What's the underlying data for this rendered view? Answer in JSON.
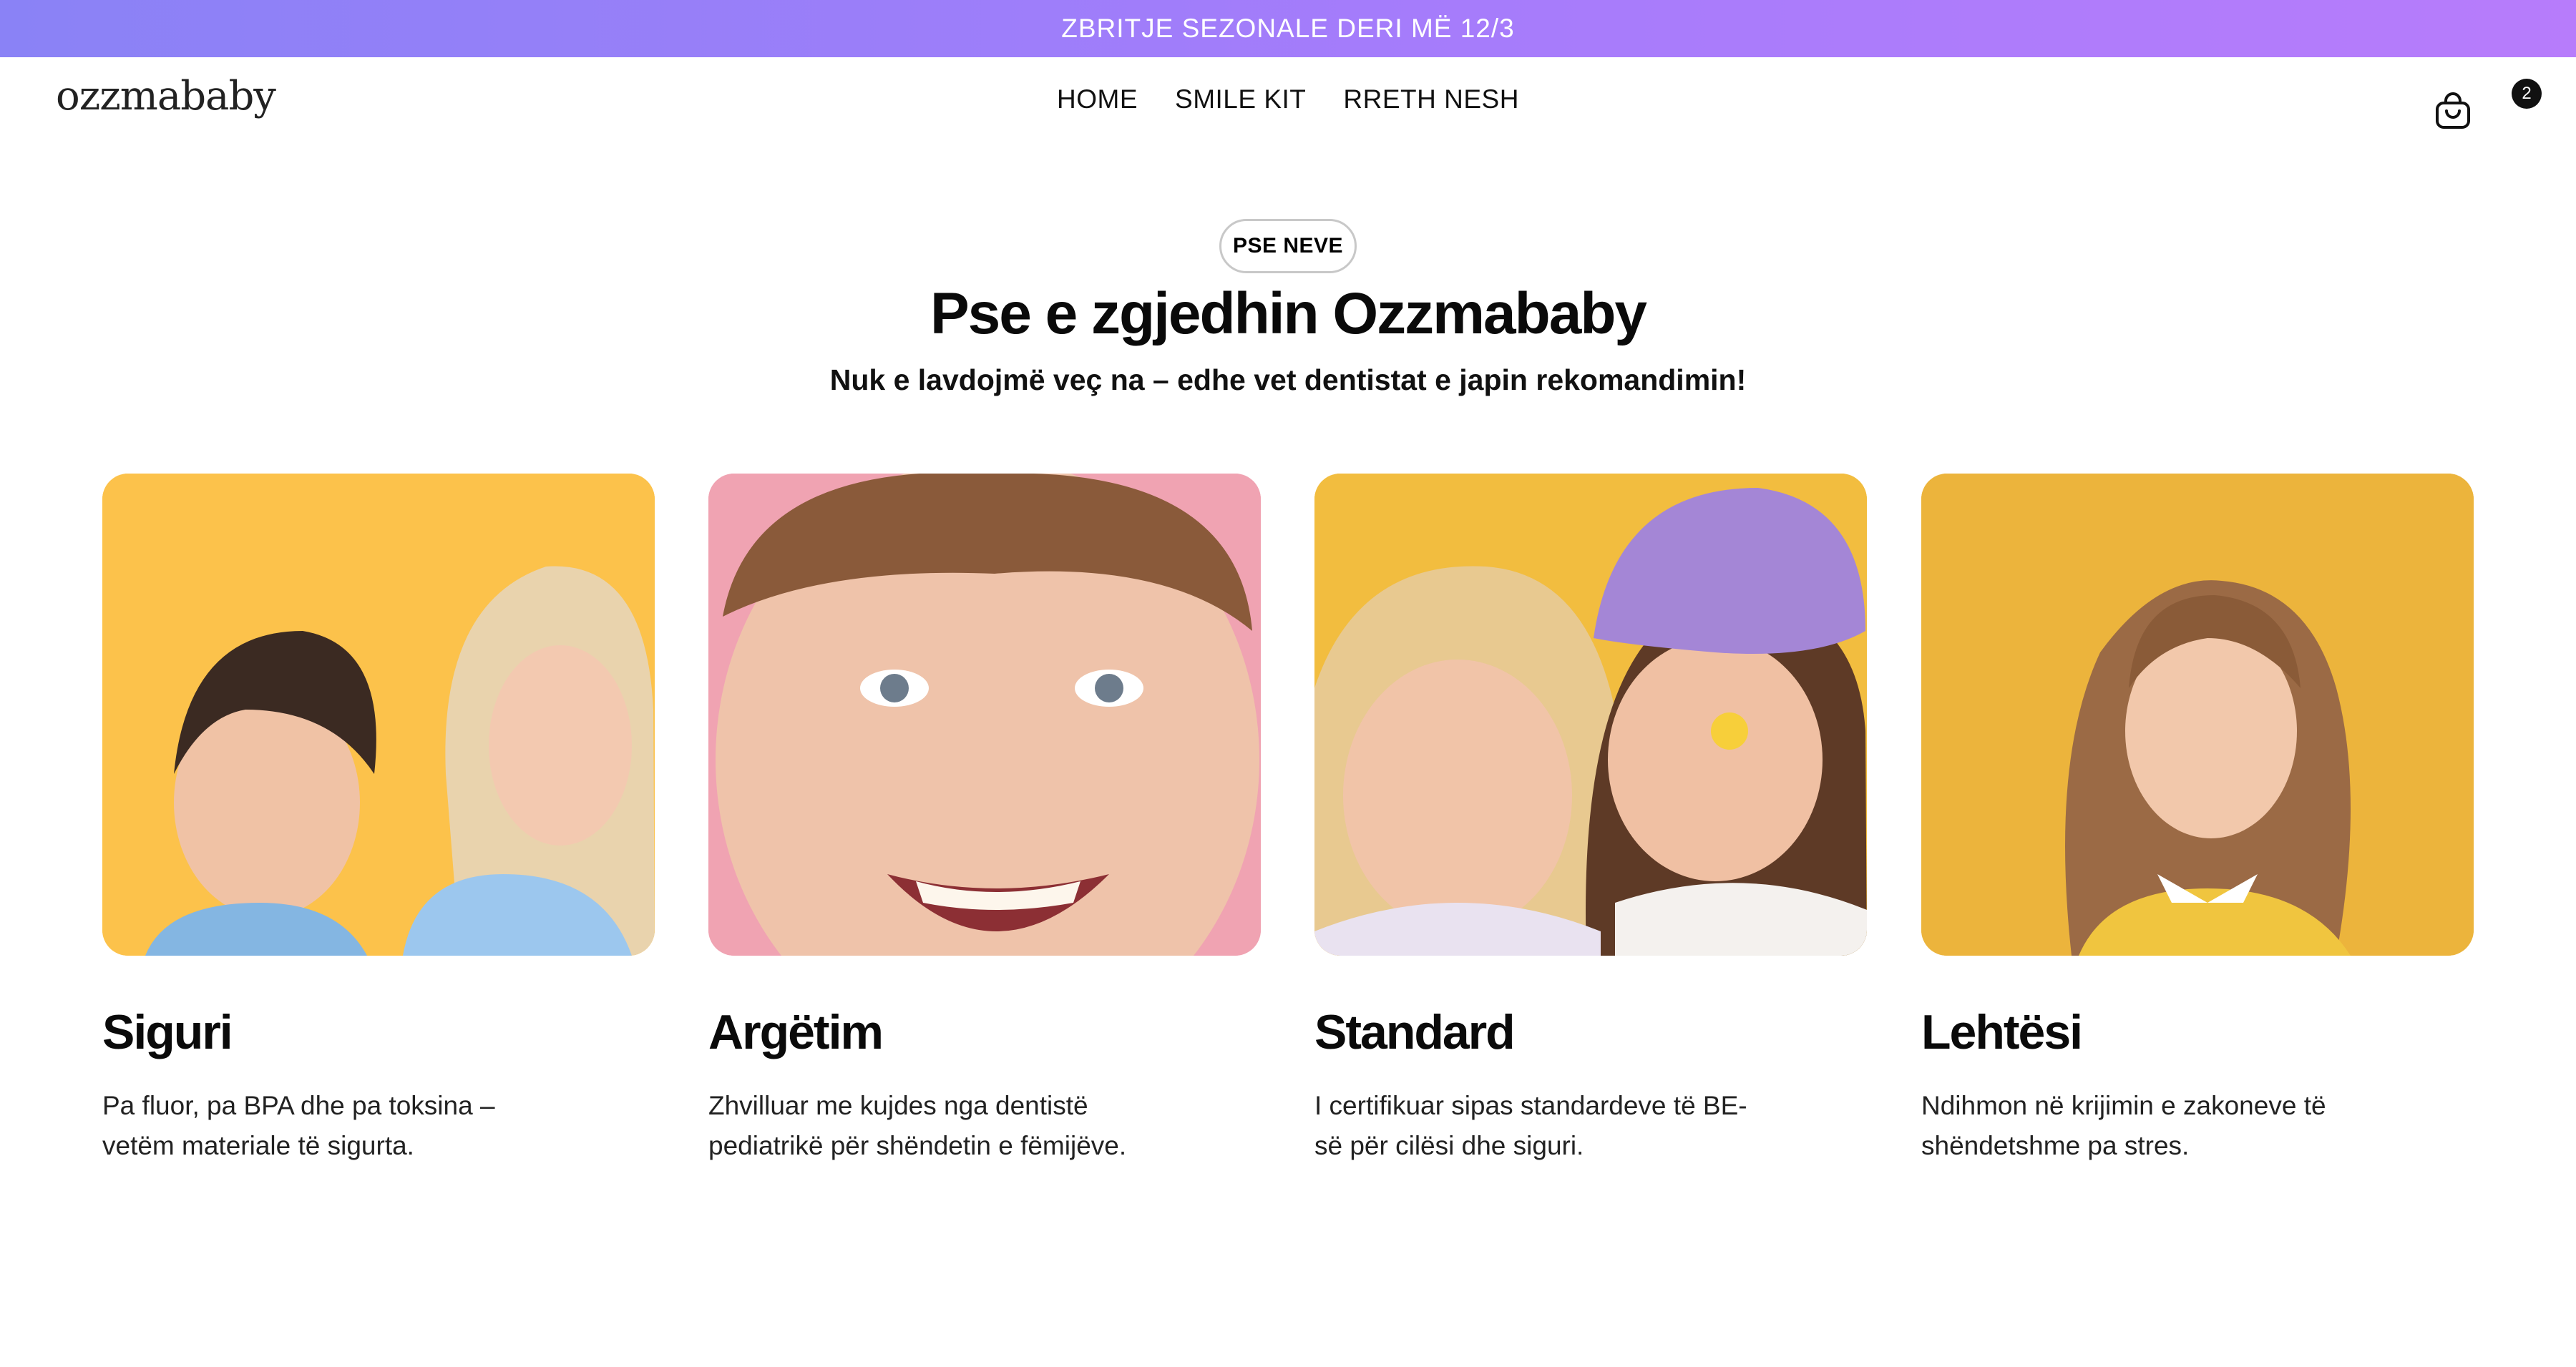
{
  "promo": {
    "text": "ZBRITJE SEZONALE DERI MË 12/3"
  },
  "header": {
    "logo": "ozzmababy",
    "nav": [
      "HOME",
      "SMILE KIT",
      "RRETH NESH"
    ],
    "cart_icon": "shopping-bag-icon",
    "cart_count": "2"
  },
  "section": {
    "pill": "PSE NEVE",
    "title": "Pse e zgjedhin Ozzmababy",
    "subtitle": "Nuk e lavdojmë veç na – edhe vet dentistat e japin rekomandimin!"
  },
  "features": [
    {
      "title": "Siguri",
      "text": "Pa fluor, pa BPA dhe pa toksina – vetëm materiale të sigurta.",
      "bg": "#fcc24b"
    },
    {
      "title": "Argëtim",
      "text": "Zhvilluar me kujdes nga dentistë pediatrikë për shëndetin e fëmijëve.",
      "bg": "#f0a3b2"
    },
    {
      "title": "Standard",
      "text": "I certifikuar sipas standardeve të BE-së për cilësi dhe siguri.",
      "bg": "#f2bd3f"
    },
    {
      "title": "Lehtësi",
      "text": "Ndihmon në krijimin e zakoneve të shëndetshme pa stres.",
      "bg": "#ecb43c"
    }
  ],
  "colors": {
    "promo_gradient_start": "#8a82f6",
    "promo_gradient_end": "#b77cfb",
    "text": "#0a0a0a"
  }
}
